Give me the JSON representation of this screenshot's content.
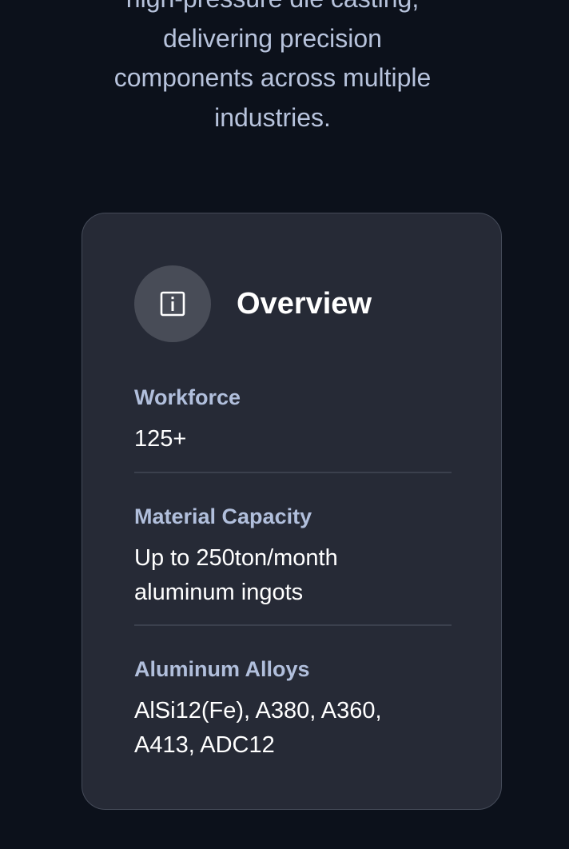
{
  "intro": {
    "lines": [
      "high-pressure die casting,",
      "delivering precision",
      "components across multiple",
      "industries."
    ]
  },
  "overview": {
    "icon": "info-icon",
    "title": "Overview",
    "items": [
      {
        "label": "Workforce",
        "value_lines": [
          "125+"
        ]
      },
      {
        "label": "Material Capacity",
        "value_lines": [
          "Up to 250ton/month",
          "aluminum ingots"
        ]
      },
      {
        "label": "Aluminum Alloys",
        "value_lines": [
          "AlSi12(Fe), A380, A360,",
          "A413, ADC12"
        ]
      }
    ]
  }
}
